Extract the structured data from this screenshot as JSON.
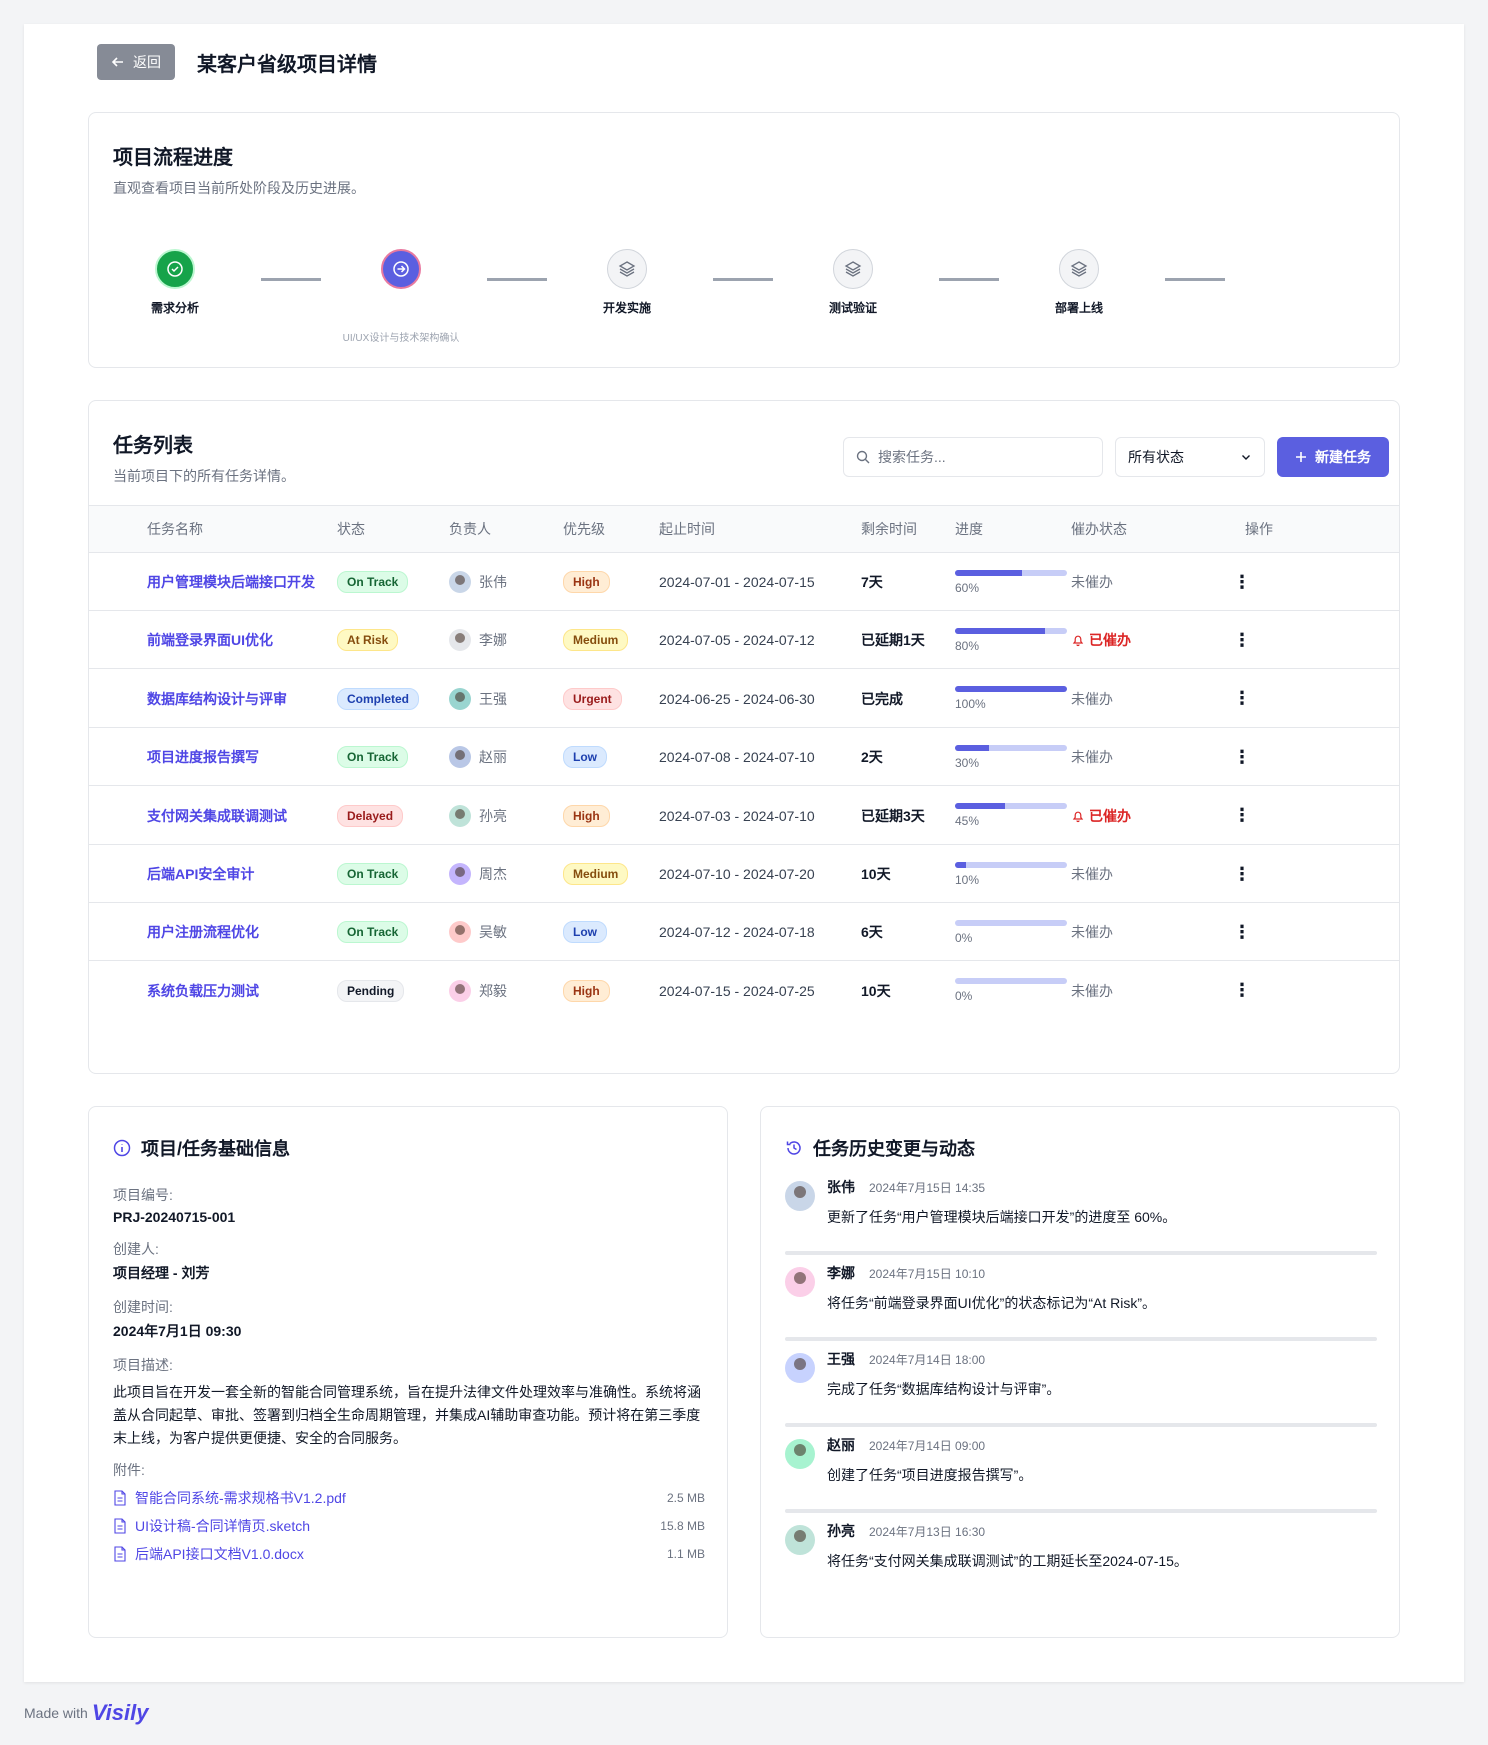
{
  "header": {
    "back_label": "返回",
    "title": "某客户省级项目详情"
  },
  "progress": {
    "title": "项目流程进度",
    "subtitle": "直观查看项目当前所处阶段及历史进展。",
    "steps": [
      {
        "label": "需求分析",
        "state": "done",
        "note": ""
      },
      {
        "label": "",
        "state": "active",
        "note": "UI/UX设计与技术架构确认"
      },
      {
        "label": "开发实施",
        "state": "todo",
        "note": ""
      },
      {
        "label": "测试验证",
        "state": "todo",
        "note": ""
      },
      {
        "label": "部署上线",
        "state": "todo",
        "note": ""
      }
    ]
  },
  "tasks": {
    "title": "任务列表",
    "subtitle": "当前项目下的所有任务详情。",
    "search_placeholder": "搜索任务...",
    "filter_value": "所有状态",
    "new_button": "新建任务",
    "columns": [
      "任务名称",
      "状态",
      "负责人",
      "优先级",
      "起止时间",
      "剩余时间",
      "进度",
      "催办状态",
      "操作"
    ],
    "rows": [
      {
        "name": "用户管理模块后端接口开发",
        "status": "On Track",
        "status_cls": "b-ontrack",
        "owner": "张伟",
        "priority": "High",
        "priority_cls": "p-high",
        "dates": "2024-07-01 - 2024-07-15",
        "remaining": "7天",
        "progress": 60,
        "progress_label": "60%",
        "remind": "未催办",
        "reminded": false,
        "avatar_color": "#c9d6e8"
      },
      {
        "name": "前端登录界面UI优化",
        "status": "At Risk",
        "status_cls": "b-atrisk",
        "owner": "李娜",
        "priority": "Medium",
        "priority_cls": "p-medium",
        "dates": "2024-07-05 - 2024-07-12",
        "remaining": "已延期1天",
        "progress": 80,
        "progress_label": "80%",
        "remind": "已催办",
        "reminded": true,
        "avatar_color": "#e5e7eb"
      },
      {
        "name": "数据库结构设计与评审",
        "status": "Completed",
        "status_cls": "b-completed",
        "owner": "王强",
        "priority": "Urgent",
        "priority_cls": "p-urgent",
        "dates": "2024-06-25 - 2024-06-30",
        "remaining": "已完成",
        "progress": 100,
        "progress_label": "100%",
        "remind": "未催办",
        "reminded": false,
        "avatar_color": "#99d5d0"
      },
      {
        "name": "项目进度报告撰写",
        "status": "On Track",
        "status_cls": "b-ontrack",
        "owner": "赵丽",
        "priority": "Low",
        "priority_cls": "p-low",
        "dates": "2024-07-08 - 2024-07-10",
        "remaining": "2天",
        "progress": 30,
        "progress_label": "30%",
        "remind": "未催办",
        "reminded": false,
        "avatar_color": "#b9c7e6"
      },
      {
        "name": "支付网关集成联调测试",
        "status": "Delayed",
        "status_cls": "b-delayed",
        "owner": "孙亮",
        "priority": "High",
        "priority_cls": "p-high",
        "dates": "2024-07-03 - 2024-07-10",
        "remaining": "已延期3天",
        "progress": 45,
        "progress_label": "45%",
        "remind": "已催办",
        "reminded": true,
        "avatar_color": "#bfe3d9"
      },
      {
        "name": "后端API安全审计",
        "status": "On Track",
        "status_cls": "b-ontrack",
        "owner": "周杰",
        "priority": "Medium",
        "priority_cls": "p-medium",
        "dates": "2024-07-10 - 2024-07-20",
        "remaining": "10天",
        "progress": 10,
        "progress_label": "10%",
        "remind": "未催办",
        "reminded": false,
        "avatar_color": "#c4b5fd"
      },
      {
        "name": "用户注册流程优化",
        "status": "On Track",
        "status_cls": "b-ontrack",
        "owner": "吴敏",
        "priority": "Low",
        "priority_cls": "p-low",
        "dates": "2024-07-12 - 2024-07-18",
        "remaining": "6天",
        "progress": 0,
        "progress_label": "0%",
        "remind": "未催办",
        "reminded": false,
        "avatar_color": "#fecaca"
      },
      {
        "name": "系统负载压力测试",
        "status": "Pending",
        "status_cls": "b-pending",
        "owner": "郑毅",
        "priority": "High",
        "priority_cls": "p-high",
        "dates": "2024-07-15 - 2024-07-25",
        "remaining": "10天",
        "progress": 0,
        "progress_label": "0%",
        "remind": "未催办",
        "reminded": false,
        "avatar_color": "#fbcfe8"
      }
    ]
  },
  "info": {
    "title": "项目/任务基础信息",
    "project_no_label": "项目编号:",
    "project_no": "PRJ-20240715-001",
    "creator_label": "创建人:",
    "creator": "项目经理 - 刘芳",
    "created_label": "创建时间:",
    "created": "2024年7月1日 09:30",
    "desc_label": "项目描述:",
    "desc": "此项目旨在开发一套全新的智能合同管理系统，旨在提升法律文件处理效率与准确性。系统将涵盖从合同起草、审批、签署到归档全生命周期管理，并集成AI辅助审查功能。预计将在第三季度末上线，为客户提供更便捷、安全的合同服务。",
    "attach_label": "附件:",
    "files": [
      {
        "name": "智能合同系统-需求规格书V1.2.pdf",
        "size": "2.5 MB"
      },
      {
        "name": "UI设计稿-合同详情页.sketch",
        "size": "15.8 MB"
      },
      {
        "name": "后端API接口文档V1.0.docx",
        "size": "1.1 MB"
      }
    ]
  },
  "history": {
    "title": "任务历史变更与动态",
    "items": [
      {
        "who": "张伟",
        "when": "2024年7月15日 14:35",
        "what": "更新了任务“用户管理模块后端接口开发”的进度至 60%。",
        "avatar_color": "#c9d6e8"
      },
      {
        "who": "李娜",
        "when": "2024年7月15日 10:10",
        "what": "将任务“前端登录界面UI优化”的状态标记为“At Risk”。",
        "avatar_color": "#fbcfe8"
      },
      {
        "who": "王强",
        "when": "2024年7月14日 18:00",
        "what": "完成了任务“数据库结构设计与评审”。",
        "avatar_color": "#c7d2fe"
      },
      {
        "who": "赵丽",
        "when": "2024年7月14日 09:00",
        "what": "创建了任务“项目进度报告撰写”。",
        "avatar_color": "#a7f3d0"
      },
      {
        "who": "孙亮",
        "when": "2024年7月13日 16:30",
        "what": "将任务“支付网关集成联调测试”的工期延长至2024-07-15。",
        "avatar_color": "#bfe3d9"
      }
    ]
  },
  "footer": {
    "made_with": "Made with",
    "brand": "Visily"
  },
  "colors": {
    "accent": "#5b5fe0",
    "done": "#16a34a",
    "remind": "#dc2626"
  }
}
